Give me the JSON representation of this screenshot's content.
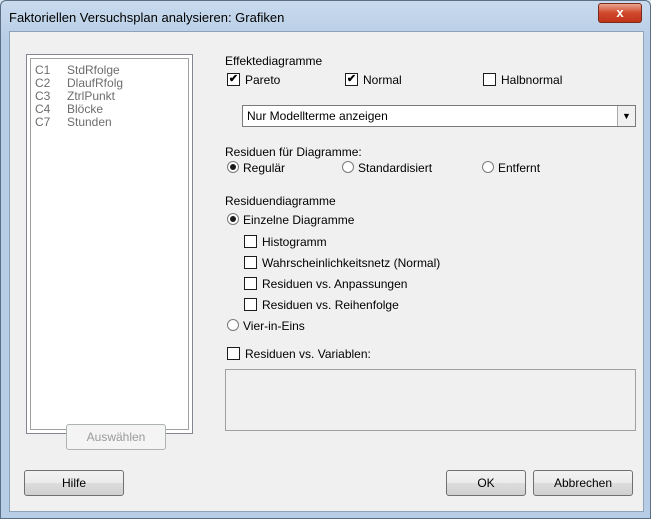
{
  "window": {
    "title": "Faktoriellen Versuchsplan analysieren: Grafiken",
    "close_label": "x"
  },
  "columns": [
    {
      "id": "C1",
      "name": "StdRfolge"
    },
    {
      "id": "C2",
      "name": "DlaufRfolg"
    },
    {
      "id": "C3",
      "name": "ZtrlPunkt"
    },
    {
      "id": "C4",
      "name": "Blöcke"
    },
    {
      "id": "C7",
      "name": "Stunden"
    }
  ],
  "select_button": "Auswählen",
  "effects": {
    "heading": "Effektediagramme",
    "pareto": {
      "label": "Pareto",
      "checked": true
    },
    "normal": {
      "label": "Normal",
      "checked": true
    },
    "halfnormal": {
      "label": "Halbnormal",
      "checked": false
    },
    "display_option": "Nur Modellterme anzeigen"
  },
  "residuals": {
    "heading": "Residuen für Diagramme:",
    "regular": "Regulär",
    "standardized": "Standardisiert",
    "deleted": "Entfernt",
    "selected": "Regulär"
  },
  "residual_plots": {
    "heading": "Residuendiagramme",
    "individual": "Einzelne Diagramme",
    "histogram": "Histogramm",
    "probability": "Wahrscheinlichkeitsnetz (Normal)",
    "vs_fits": "Residuen vs. Anpassungen",
    "vs_order": "Residuen vs. Reihenfolge",
    "four_in_one": "Vier-in-Eins",
    "selected": "Einzelne Diagramme"
  },
  "vs_variables": {
    "label": "Residuen vs. Variablen:",
    "checked": false
  },
  "buttons": {
    "help": "Hilfe",
    "ok": "OK",
    "cancel": "Abbrechen"
  },
  "colors": {
    "titlebar": "#c9daed",
    "close": "#d0472b",
    "dialog": "#f0f0f0"
  }
}
